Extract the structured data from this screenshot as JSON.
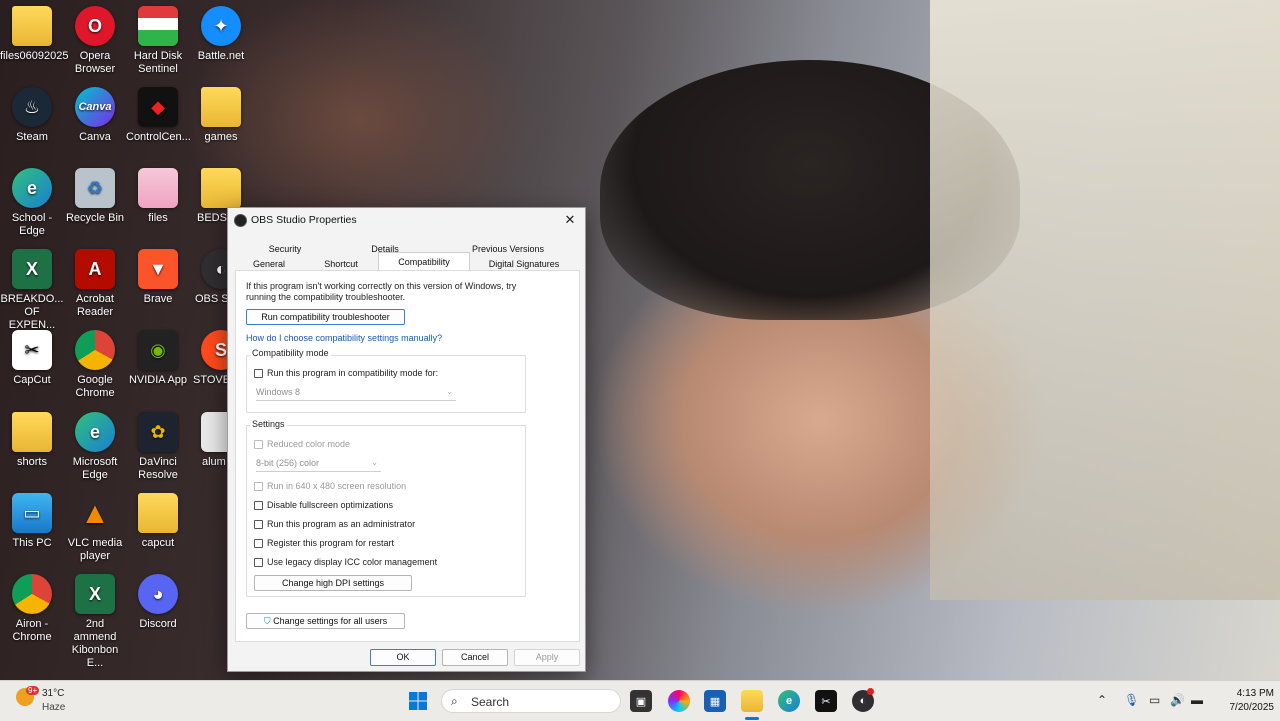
{
  "desktop": {
    "icons": [
      {
        "label": "files06092025"
      },
      {
        "label": "Opera Browser"
      },
      {
        "label": "Hard Disk Sentinel"
      },
      {
        "label": "Battle.net"
      },
      {
        "label": "Steam"
      },
      {
        "label": "Canva"
      },
      {
        "label": "ControlCen..."
      },
      {
        "label": "games"
      },
      {
        "label": "School - Edge"
      },
      {
        "label": "Recycle Bin"
      },
      {
        "label": "files"
      },
      {
        "label": "BEDS"
      },
      {
        "label": "BREAKDO... OF EXPEN..."
      },
      {
        "label": "Acrobat Reader"
      },
      {
        "label": "Brave"
      },
      {
        "label": "OBS St"
      },
      {
        "label": "CapCut"
      },
      {
        "label": "Google Chrome"
      },
      {
        "label": "NVIDIA App"
      },
      {
        "label": "STOVE("
      },
      {
        "label": "shorts"
      },
      {
        "label": "Microsoft Edge"
      },
      {
        "label": "DaVinci Resolve"
      },
      {
        "label": "alum"
      },
      {
        "label": "This PC"
      },
      {
        "label": "VLC media player"
      },
      {
        "label": "capcut"
      },
      {
        "label": "Airon - Chrome"
      },
      {
        "label": "2nd ammend Kibonbon E..."
      },
      {
        "label": "Discord"
      }
    ]
  },
  "dialog": {
    "title": "OBS Studio Properties",
    "tabs_row1": [
      "Security",
      "Details",
      "Previous Versions"
    ],
    "tabs_row2": [
      "General",
      "Shortcut",
      "Compatibility",
      "Digital Signatures"
    ],
    "intro": "If this program isn't working correctly on this version of Windows, try running the compatibility troubleshooter.",
    "troubleshooter_button": "Run compatibility troubleshooter",
    "manual_link": "How do I choose compatibility settings manually?",
    "compat_mode": {
      "title": "Compatibility mode",
      "checkbox_label": "Run this program in compatibility mode for:",
      "select_value": "Windows 8"
    },
    "settings": {
      "title": "Settings",
      "reduced_color": "Reduced color mode",
      "color_select": "8-bit (256) color",
      "run_640": "Run in 640 x 480 screen resolution",
      "disable_fullscreen": "Disable fullscreen optimizations",
      "run_admin": "Run this program as an administrator",
      "register_restart": "Register this program for restart",
      "legacy_icc": "Use legacy display ICC color management",
      "dpi_button": "Change high DPI settings"
    },
    "all_users_button": "Change settings for all users",
    "ok": "OK",
    "cancel": "Cancel",
    "apply": "Apply"
  },
  "taskbar": {
    "weather_temp": "31°C",
    "weather_desc": "Haze",
    "weather_badge": "9+",
    "search_placeholder": "Search",
    "time": "4:13 PM",
    "date": "7/20/2025"
  }
}
